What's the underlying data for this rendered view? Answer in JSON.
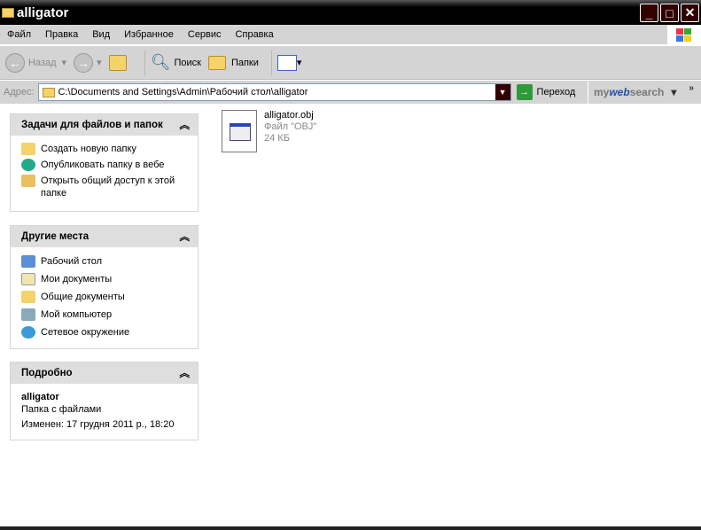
{
  "window": {
    "title": "alligator",
    "min": "_",
    "max": "□",
    "close": "✕"
  },
  "menu": [
    "Файл",
    "Правка",
    "Вид",
    "Избранное",
    "Сервис",
    "Справка"
  ],
  "toolbar": {
    "back": "Назад",
    "search": "Поиск",
    "folders": "Папки"
  },
  "address": {
    "label": "Адрес:",
    "value": "C:\\Documents and Settings\\Admin\\Рабочий стол\\alligator",
    "go": "Переход",
    "brand_my": "my",
    "brand_web": "web",
    "brand_search": "search",
    "more": "»"
  },
  "tasks": {
    "title": "Задачи для файлов и папок",
    "items": [
      "Создать новую папку",
      "Опубликовать папку в вебе",
      "Открыть общий доступ к этой папке"
    ]
  },
  "places": {
    "title": "Другие места",
    "items": [
      "Рабочий стол",
      "Мои документы",
      "Общие документы",
      "Мой компьютер",
      "Сетевое окружение"
    ]
  },
  "details": {
    "title": "Подробно",
    "name": "alligator",
    "type": "Папка с файлами",
    "modified": "Изменен: 17 грудня 2011 р., 18:20"
  },
  "file": {
    "name": "alligator.obj",
    "type": "Файл \"OBJ\"",
    "size": "24 КБ"
  },
  "colors": {
    "titlebar": "#000000",
    "chrome": "#d4d4d4"
  }
}
